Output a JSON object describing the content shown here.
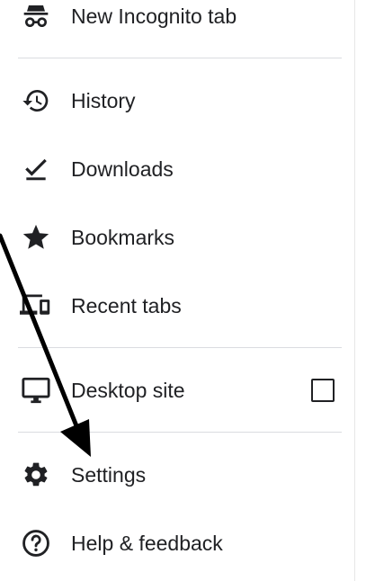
{
  "menu": {
    "items": [
      {
        "label": "New Incognito tab",
        "icon": "incognito-icon"
      },
      {
        "label": "History",
        "icon": "history-icon"
      },
      {
        "label": "Downloads",
        "icon": "download-done-icon"
      },
      {
        "label": "Bookmarks",
        "icon": "star-icon"
      },
      {
        "label": "Recent tabs",
        "icon": "devices-icon"
      },
      {
        "label": "Desktop site",
        "icon": "desktop-icon",
        "checked": false
      },
      {
        "label": "Settings",
        "icon": "gear-icon"
      },
      {
        "label": "Help & feedback",
        "icon": "help-icon"
      }
    ]
  },
  "colors": {
    "text": "#202124",
    "divider": "#dadce0",
    "annotation_arrow": "#000000"
  }
}
